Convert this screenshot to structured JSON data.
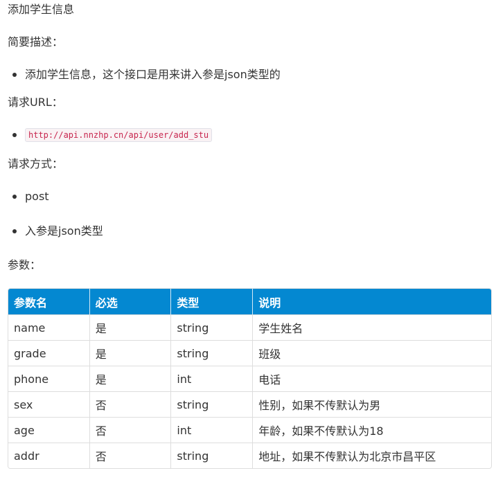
{
  "title": "添加学生信息",
  "brief_heading": "简要描述：",
  "brief_items": [
    "添加学生信息，这个接口是用来讲入参是json类型的"
  ],
  "url_heading": "请求URL：",
  "url": "http://api.nnzhp.cn/api/user/add_stu",
  "method_heading": "请求方式：",
  "method_items": [
    "post",
    "入参是json类型"
  ],
  "params_heading": "参数：",
  "table": {
    "headers": [
      "参数名",
      "必选",
      "类型",
      "说明"
    ],
    "rows": [
      [
        "name",
        "是",
        "string",
        "学生姓名"
      ],
      [
        "grade",
        "是",
        "string",
        "班级"
      ],
      [
        "phone",
        "是",
        "int",
        "电话"
      ],
      [
        "sex",
        "否",
        "string",
        "性别，如果不传默认为男"
      ],
      [
        "age",
        "否",
        "int",
        "年龄，如果不传默认为18"
      ],
      [
        "addr",
        "否",
        "string",
        "地址，如果不传默认为北京市昌平区"
      ]
    ]
  },
  "colors": {
    "table_header_bg": "#0488d1",
    "code_text": "#c7254e"
  }
}
